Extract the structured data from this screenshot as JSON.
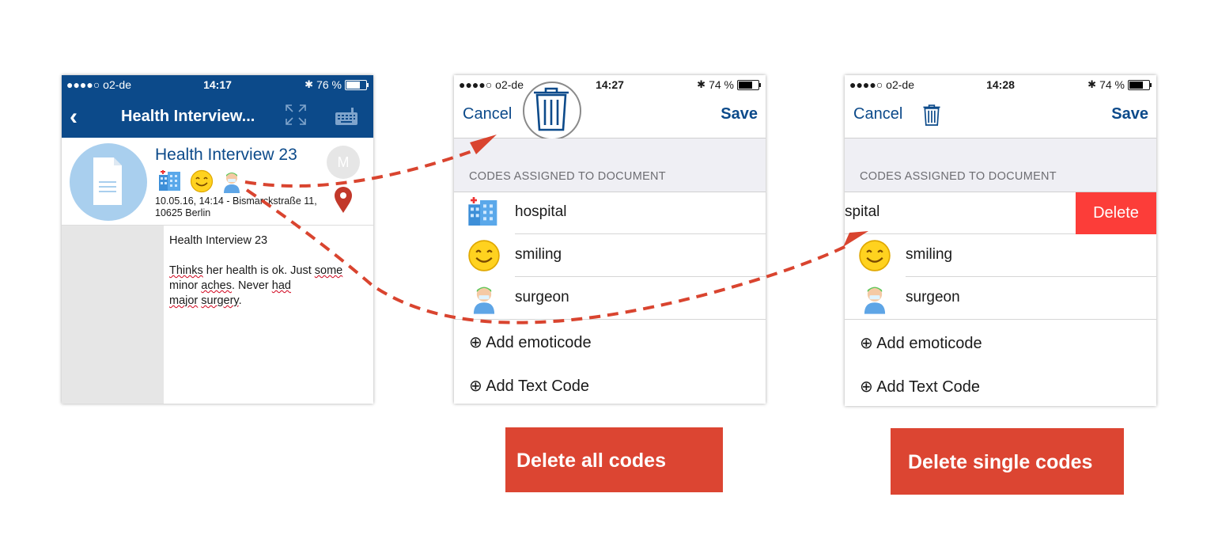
{
  "screens": {
    "editor": {
      "status": {
        "carrier": "●●●●○ o2-de",
        "time": "14:17",
        "battery": "76 %"
      },
      "nav": {
        "title": "Health Interview..."
      },
      "header": {
        "title": "Health Interview 23",
        "meta": "10.05.16, 14:14 - Bismarckstraße 11, 10625 Berlin",
        "avatar_letter": "M"
      },
      "body": {
        "title": "Health Interview 23",
        "p_thinks": "Thinks",
        "p_mid1": " her health is ok. Just ",
        "p_some": "some",
        "p_mid2": " minor ",
        "p_aches": "aches",
        "p_mid3": ". Never ",
        "p_had": "had",
        "p_major": "major",
        "p_space": " ",
        "p_surgery": "surgery",
        "p_end": "."
      }
    },
    "codes_all": {
      "status": {
        "carrier": "●●●●○ o2-de",
        "time": "14:27",
        "battery": "74 %"
      },
      "nav": {
        "cancel": "Cancel",
        "save": "Save"
      },
      "section_label": "CODES ASSIGNED TO DOCUMENT",
      "codes": [
        "hospital",
        "smiling",
        "surgeon"
      ],
      "add_emoticode": "⊕ Add emoticode",
      "add_text_code": "⊕ Add Text Code"
    },
    "codes_single": {
      "status": {
        "carrier": "●●●●○ o2-de",
        "time": "14:28",
        "battery": "74 %"
      },
      "nav": {
        "cancel": "Cancel",
        "save": "Save"
      },
      "section_label": "CODES ASSIGNED TO DOCUMENT",
      "codes": [
        "spital",
        "smiling",
        "surgeon"
      ],
      "delete": "Delete",
      "add_emoticode": "⊕ Add emoticode",
      "add_text_code": "⊕ Add Text Code"
    }
  },
  "captions": {
    "delete_all": "Delete all codes",
    "delete_single": "Delete single codes"
  },
  "colors": {
    "nav_blue": "#0c4a8a",
    "caption_red": "#dc4532",
    "delete_red": "#fc3d39",
    "arrow_red": "#d9442f"
  },
  "icons": [
    "hospital-icon",
    "smiley-icon",
    "surgeon-icon",
    "trash-icon",
    "map-pin-icon",
    "document-icon",
    "expand-icon",
    "keyboard-icon"
  ]
}
